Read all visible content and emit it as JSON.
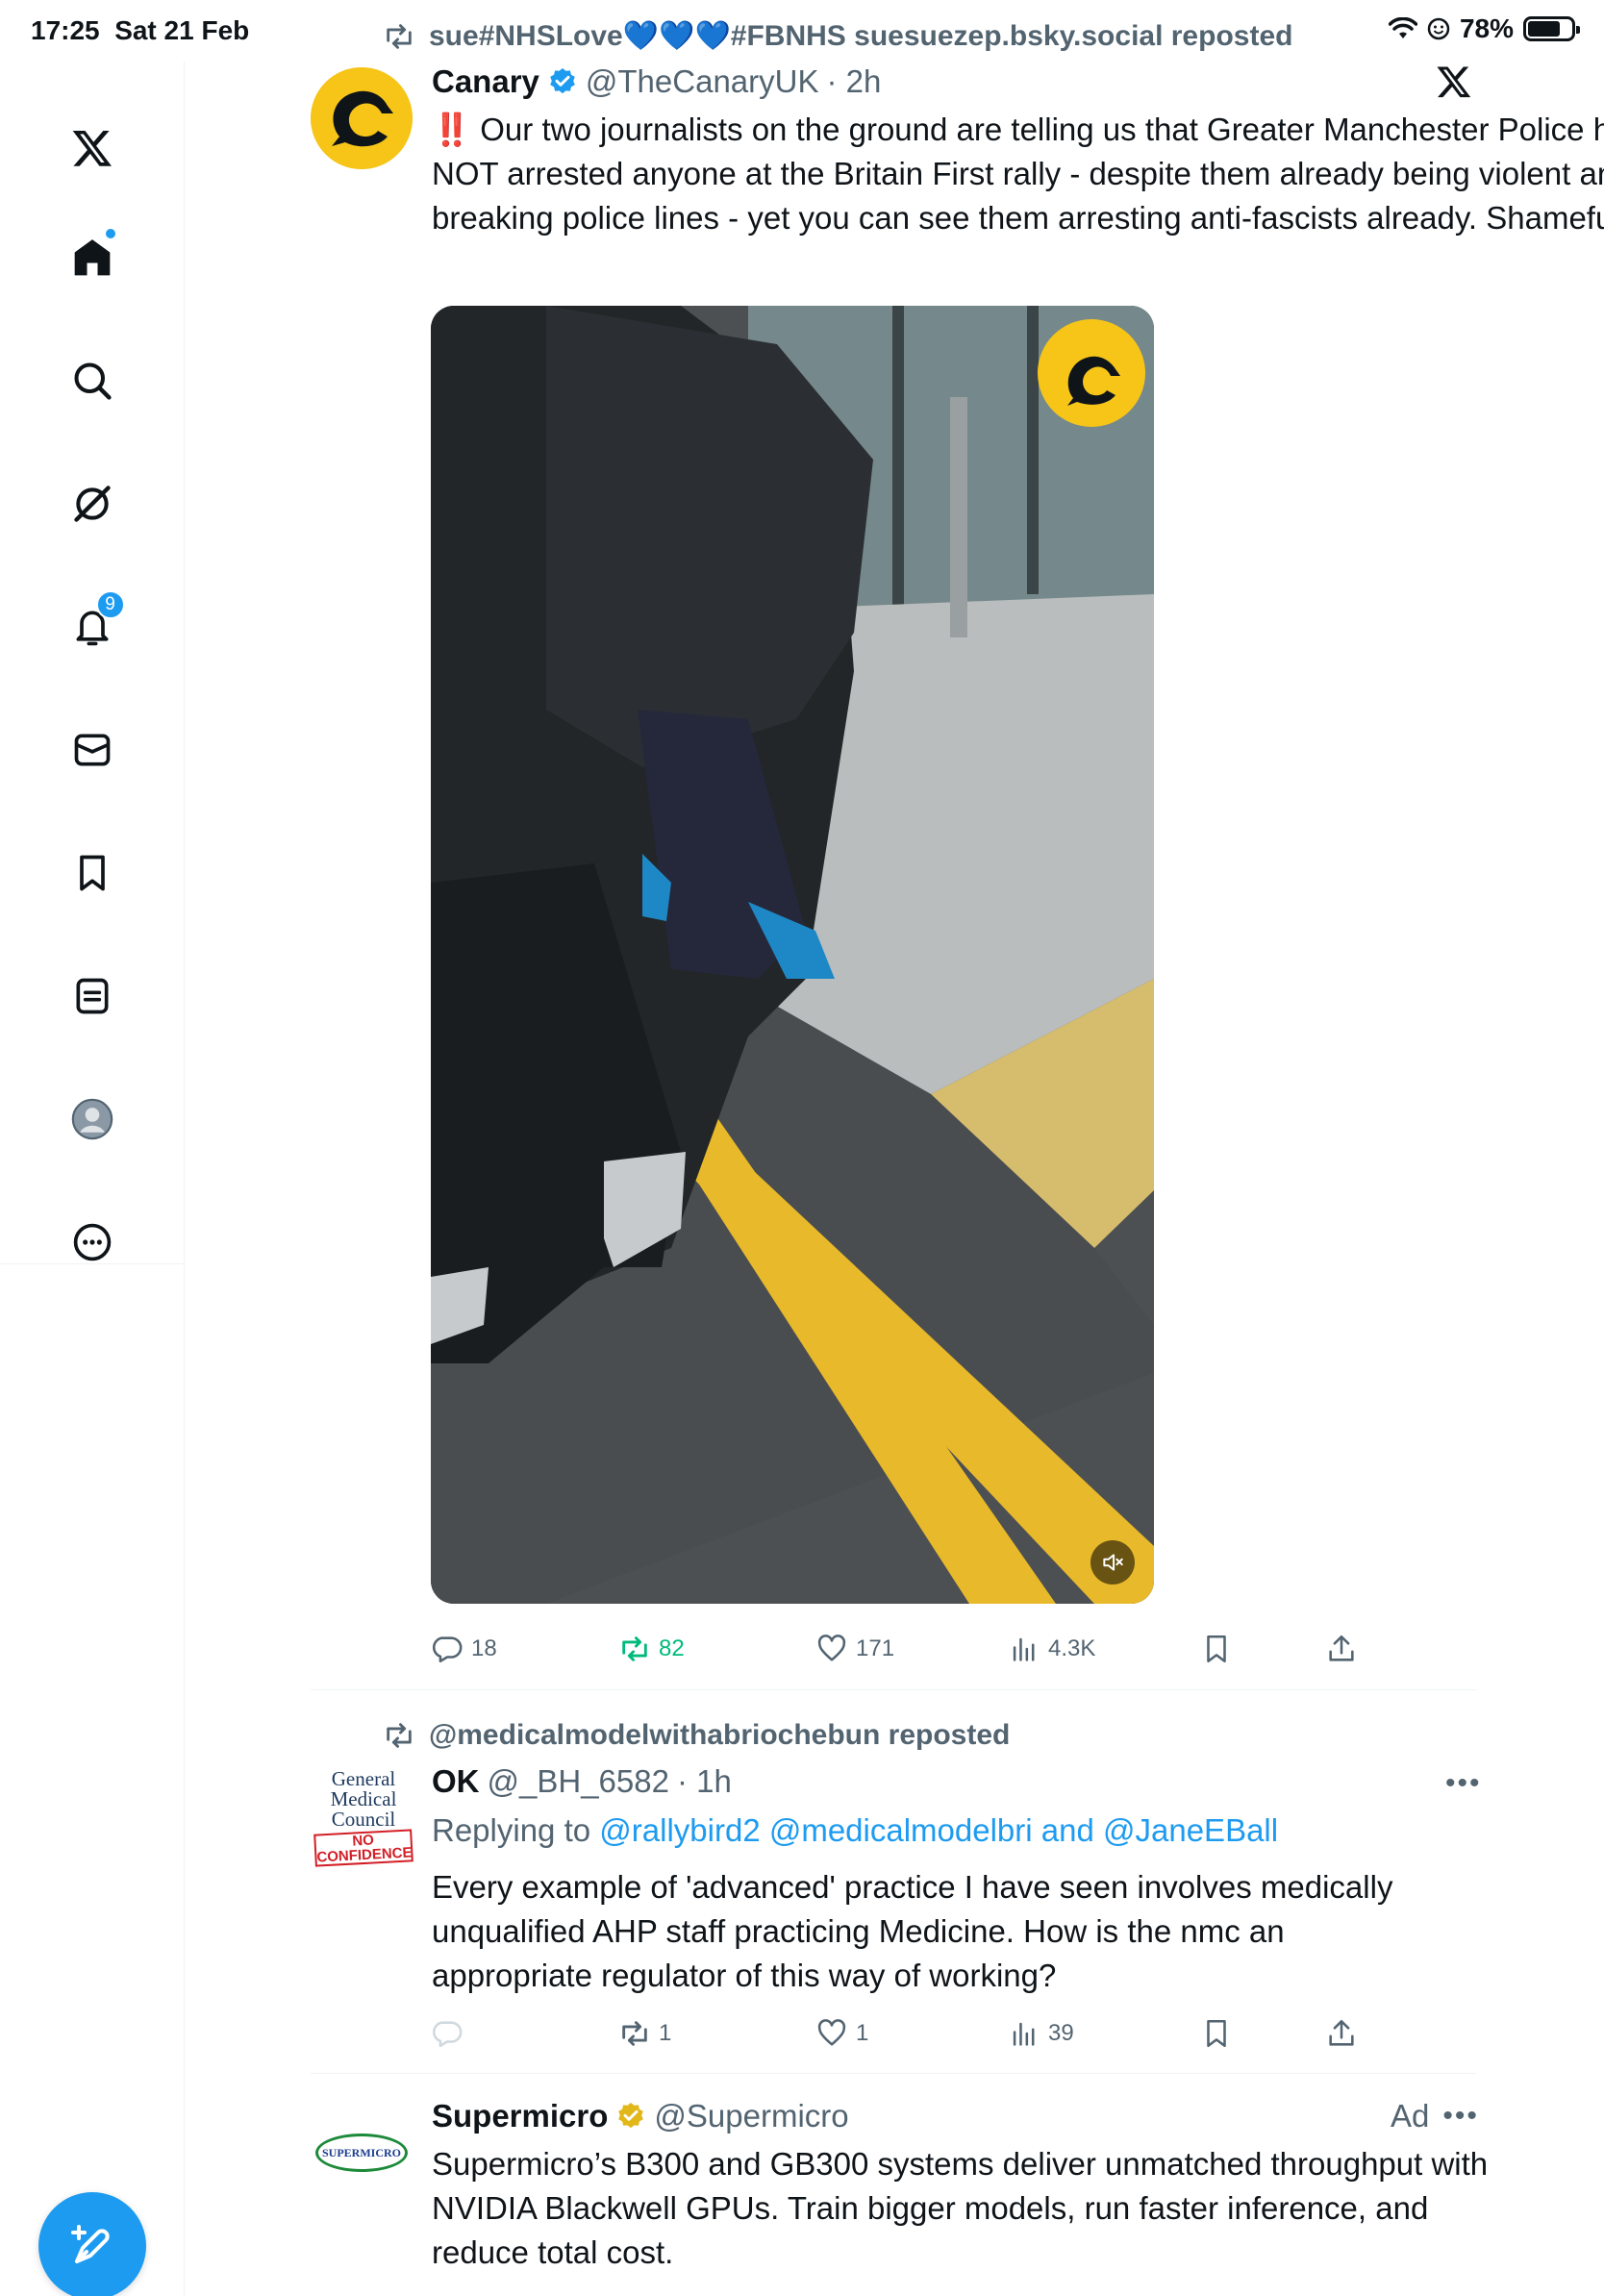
{
  "status_bar": {
    "time": "17:25",
    "date": "Sat 21 Feb",
    "battery": "78%",
    "battery_level": 0.78
  },
  "sidebar": {
    "items": [
      {
        "name": "home",
        "label": "Home"
      },
      {
        "name": "explore",
        "label": "Explore"
      },
      {
        "name": "grok",
        "label": "Grok"
      },
      {
        "name": "notifications",
        "label": "Notifications",
        "badge": "9"
      },
      {
        "name": "messages",
        "label": "Messages"
      },
      {
        "name": "bookmarks",
        "label": "Bookmarks"
      },
      {
        "name": "lists",
        "label": "Lists"
      },
      {
        "name": "profile",
        "label": "Profile"
      },
      {
        "name": "more",
        "label": "More"
      }
    ]
  },
  "posts": [
    {
      "repost_by": "sue#NHSLove💙💙💙#FBNHS suesuezep.bsky.social reposted",
      "display_name": "Canary",
      "handle": "@TheCanaryUK",
      "time": "· 2h",
      "verified_color": "#1d9bf0",
      "emoji": "‼️",
      "text": "Our two journalists on the ground are telling us that Greater Manchester Police have NOT arrested anyone at the Britain First rally - despite them already being violent and breaking police lines - yet you can see them arresting anti-fascists already. Shameful.",
      "replies": "18",
      "reposts": "82",
      "likes": "171",
      "views": "4.3K",
      "repost_active_color": "#00ba7c"
    },
    {
      "repost_by": "@medicalmodelwithabriochebun reposted",
      "display_name": "OK",
      "handle": "@_BH_6582",
      "time": "· 1h",
      "avatar_text": [
        "General",
        "Medical",
        "Council",
        "NO",
        "CONFIDENCE"
      ],
      "replying_prefix": "Replying to",
      "replying_to": "@rallybird2 @medicalmodelbri and @JaneEBall",
      "text": "Every example of 'advanced' practice I have seen involves medically unqualified AHP staff practicing Medicine. How is the nmc an appropriate regulator of this way of working?",
      "replies": "",
      "reposts": "1",
      "likes": "1",
      "views": "39"
    },
    {
      "display_name": "Supermicro",
      "handle": "@Supermicro",
      "verified_color": "#e2b719",
      "ad_label": "Ad",
      "avatar_text": "SUPERMICRO",
      "text": "Supermicro’s B300 and GB300 systems deliver unmatched throughput with NVIDIA Blackwell GPUs. Train bigger models, run faster inference, and reduce total cost."
    }
  ]
}
